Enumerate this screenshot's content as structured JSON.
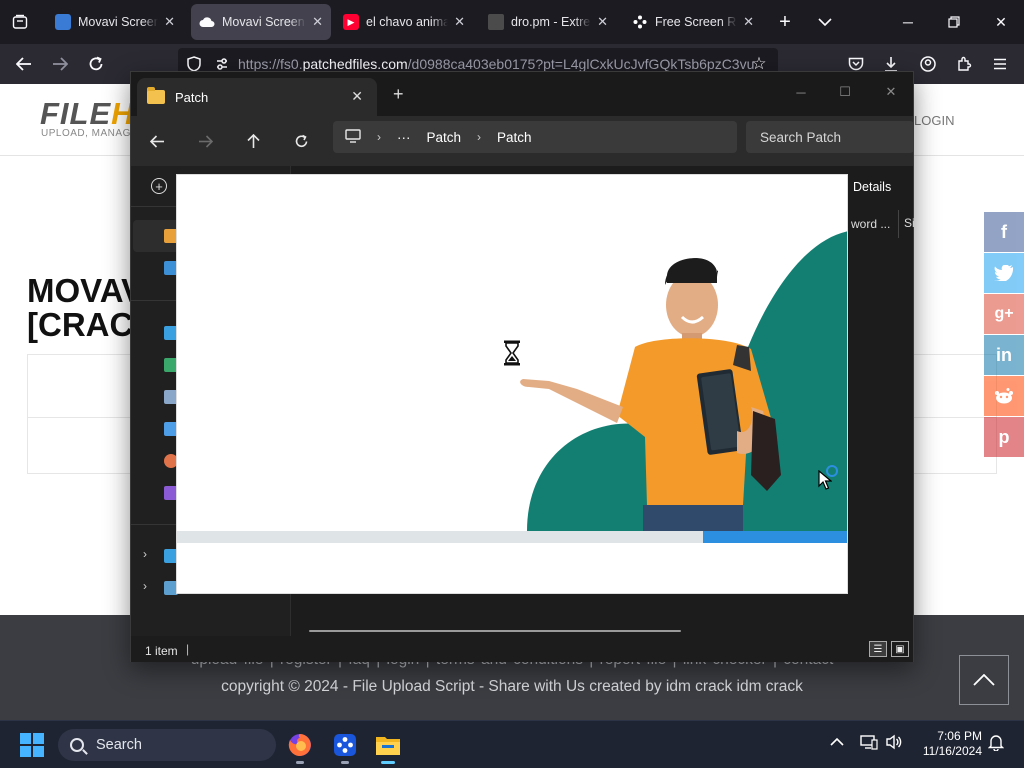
{
  "browser": {
    "tabs": [
      {
        "label": "Movavi Screen R",
        "favicon_color": "#3a7bd5",
        "active": false
      },
      {
        "label": "Movavi Screen R",
        "favicon_color": "#ffffff",
        "active": true
      },
      {
        "label": "el chavo animad",
        "favicon_color": "#ff0033",
        "active": false
      },
      {
        "label": "dro.pm - Extrem",
        "favicon_color": "#555555",
        "active": false
      },
      {
        "label": "Free Screen Reco",
        "favicon_color": "#ffffff",
        "active": false
      }
    ],
    "url_path": "https://fs0.",
    "url_host": "patchedfiles.com",
    "url_rest": "/d0988ca403eb0175?pt=L4glCxkUcJvfGQkTsb6pzC3vu"
  },
  "site": {
    "logo_main": "FILE",
    "logo_accent": "H",
    "logo_sub": "UPLOAD, MANAGE",
    "login": "LOGIN",
    "title_line1": "MOVAV",
    "title_line2": "[CRAC",
    "footer_links": "upload file  |  register  |  faq  |  login  |  terms and conditions  |  report file  |  link checker  |  contact",
    "copyright": "copyright © 2024 - File Upload Script - Share with Us created by idm crack idm crack",
    "social": [
      {
        "name": "facebook",
        "glyph": "f",
        "color": "#3b5998"
      },
      {
        "name": "twitter",
        "glyph": "t",
        "color": "#1da1f2"
      },
      {
        "name": "google-plus",
        "glyph": "g+",
        "color": "#dd4b39"
      },
      {
        "name": "linkedin",
        "glyph": "in",
        "color": "#0e76a8"
      },
      {
        "name": "reddit",
        "glyph": "r",
        "color": "#ff4500"
      },
      {
        "name": "pinterest",
        "glyph": "p",
        "color": "#cb2027"
      }
    ]
  },
  "explorer": {
    "tab_title": "Patch",
    "breadcrumb": [
      "Patch",
      "Patch"
    ],
    "search_placeholder": "Search Patch",
    "details_label": "Details",
    "column_word": "word ...",
    "column_si": "Si",
    "status_count": "1 item"
  },
  "splash": {
    "progress": 0.78,
    "accent": "#1a8a7a",
    "progress_color": "#2c8fe0"
  },
  "taskbar": {
    "search_label": "Search",
    "time": "7:06 PM",
    "date": "11/16/2024"
  }
}
